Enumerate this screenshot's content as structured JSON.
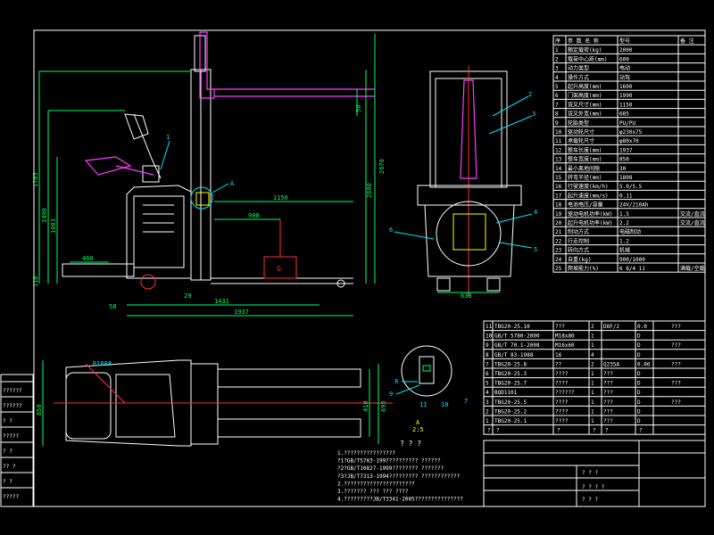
{
  "drawing": {
    "load_label": "G",
    "label_A": "A",
    "balloon_1": "1",
    "dims": {
      "d1765": "1765",
      "d1490": "1490",
      "d1083": "1083",
      "d460": "460",
      "d118": "118",
      "d50": "50",
      "d2670": "2670",
      "d2600": "2600",
      "d1150": "1150",
      "d900": "900",
      "d1431": "1431",
      "d1937": "1937",
      "d58": "58",
      "d29": "29",
      "d650": "650",
      "d850": "850",
      "d410": "410",
      "d695": "695",
      "r1808": "R1808",
      "d638": "638"
    },
    "front_labels": [
      "2",
      "3",
      "4",
      "5",
      "6"
    ],
    "detail_labels": [
      "8",
      "9",
      "11",
      "10",
      "7"
    ],
    "detail_scale": "A\n2:5",
    "qmarks": "? ? ?"
  },
  "params_table": {
    "header": [
      "序",
      "参 数 名 称",
      "型号",
      "备 注"
    ],
    "rows": [
      [
        "1",
        "额定载荷(kg)",
        "2000",
        ""
      ],
      [
        "2",
        "载荷中心距(mm)",
        "600",
        ""
      ],
      [
        "3",
        "动力类型",
        "电动",
        ""
      ],
      [
        "4",
        "操作方式",
        "站驾",
        ""
      ],
      [
        "5",
        "起升高度(mm)",
        "1600",
        ""
      ],
      [
        "6",
        "门架高度(mm)",
        "1990",
        ""
      ],
      [
        "7",
        "货叉尺寸(mm)",
        "1150",
        ""
      ],
      [
        "8",
        "货叉外宽(mm)",
        "685",
        ""
      ],
      [
        "9",
        "轮胎类型",
        "PU/PU",
        ""
      ],
      [
        "10",
        "驱动轮尺寸",
        "φ230x75",
        ""
      ],
      [
        "11",
        "承载轮尺寸",
        "φ80x70",
        ""
      ],
      [
        "12",
        "整车长度(mm)",
        "1937",
        ""
      ],
      [
        "13",
        "整车宽度(mm)",
        "850",
        ""
      ],
      [
        "14",
        "最小离地间隙",
        "30",
        ""
      ],
      [
        "15",
        "转弯半径(mm)",
        "1808",
        ""
      ],
      [
        "16",
        "行驶速度(km/h)",
        "5.0/5.5",
        ""
      ],
      [
        "17",
        "起升速度(mm/s)",
        "0.11",
        ""
      ],
      [
        "18",
        "电池电压/容量",
        "24V/210Ah",
        ""
      ],
      [
        "19",
        "驱动电机功率(kW)",
        "1.5",
        "交流/直流"
      ],
      [
        "20",
        "起升电机功率(kW)",
        "2.2",
        "交流/直流"
      ],
      [
        "21",
        "制动方式",
        "电磁制动",
        ""
      ],
      [
        "22",
        "行走控制",
        "1.2",
        ""
      ],
      [
        "23",
        "转向方式",
        "机械",
        ""
      ],
      [
        "24",
        "自重(kg)",
        "900/1000",
        ""
      ],
      [
        "25",
        "爬坡能力(%)",
        "6 8/4 11",
        "满载/空载"
      ]
    ]
  },
  "bom_table": {
    "rows": [
      [
        "11",
        "TBG20-25.10",
        "???",
        "2",
        "D8F/2",
        "0.0"
      ],
      [
        "10",
        "GB/T 5780-2000",
        "M18x80",
        "1",
        "",
        "D"
      ],
      [
        "9",
        "GB/T 70.1-2008",
        "M16x60",
        "1",
        "",
        "D"
      ],
      [
        "8",
        "GB/T 83-1988",
        "16",
        "4",
        "",
        "D"
      ],
      [
        "7",
        "TBG20-25.8",
        "??",
        "2",
        "Q235A",
        "0.06"
      ],
      [
        "6",
        "TBG20-25.3",
        "????",
        "1",
        "???",
        "D"
      ],
      [
        "5",
        "TBG20-25.7",
        "????",
        "1",
        "???",
        "D"
      ],
      [
        "4",
        "BQD1101",
        "??????",
        "1",
        "???",
        "D"
      ],
      [
        "3",
        "TBG20-25.5",
        "????",
        "1",
        "???",
        "D"
      ],
      [
        "2",
        "TBG20-25.2",
        "????",
        "1",
        "???",
        "D"
      ],
      [
        "1",
        "TBG20-25.1",
        "????",
        "1",
        "???",
        "D"
      ]
    ],
    "extra": [
      "???",
      "???",
      "???",
      "???",
      "???"
    ],
    "header": [
      "?",
      "?",
      "?",
      "?",
      "?",
      "?"
    ]
  },
  "left_strip": [
    "??????",
    "??????",
    "? ?",
    "?????",
    "? ?",
    "?? ?",
    "? ?",
    "?????"
  ],
  "notes": [
    "1.????????????????",
    "?1?GB/T5783-1997????????? ??????",
    "?2?GB/T10827-1999???????? ???????",
    "?3?JB/T7313-1994????????? ????????????",
    "2.??????????????????????",
    "3.??????? ???  ??? ????",
    "4.?????????JB/T3341-2005???????????????"
  ],
  "title_block": [
    "? ? ?",
    "? ? ? ?",
    "? ? ?"
  ]
}
